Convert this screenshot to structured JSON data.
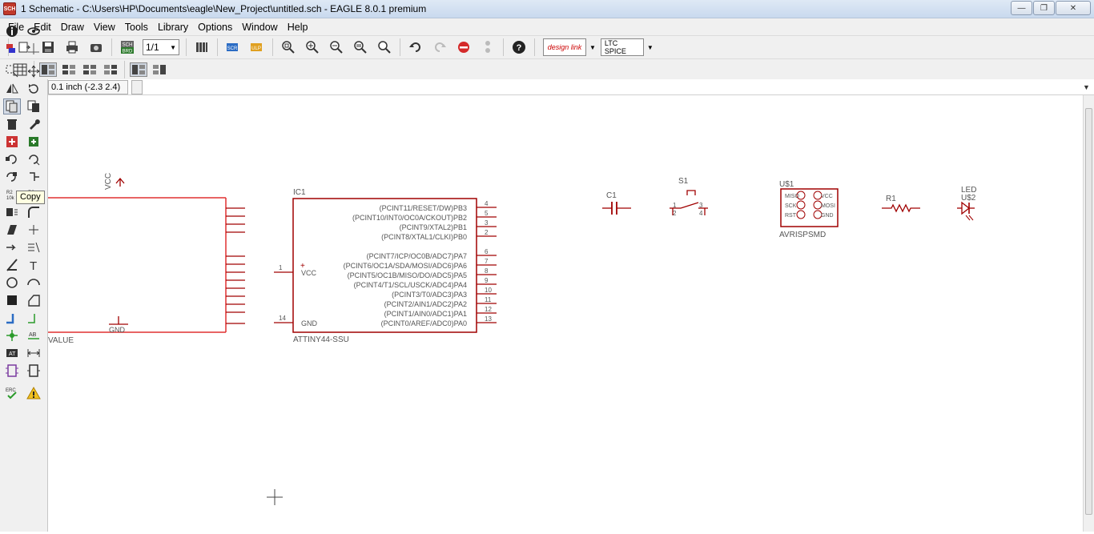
{
  "window": {
    "title": "1 Schematic - C:\\Users\\HP\\Documents\\eagle\\New_Project\\untitled.sch - EAGLE 8.0.1 premium",
    "icon_label": "SCH"
  },
  "menu": [
    "File",
    "Edit",
    "Draw",
    "View",
    "Tools",
    "Library",
    "Options",
    "Window",
    "Help"
  ],
  "toolbar": {
    "sheet_select": "1/1",
    "sch_brd_label": "SCH BRD",
    "design_link_label": "design link",
    "ltc_spice_label": "LTC SPICE"
  },
  "command": {
    "coordinate_display": "0.1 inch (-2.3 2.4)",
    "input_value": ""
  },
  "tooltip": "Copy",
  "schematic": {
    "frame_part": {
      "value_label": "VALUE",
      "vcc_label": "VCC",
      "gnd_label": "GND"
    },
    "ic1": {
      "name": "IC1",
      "value": "ATTINY44-SSU",
      "left_pins": [
        {
          "num": "1",
          "name": "VCC"
        },
        {
          "num": "14",
          "name": "GND"
        }
      ],
      "right_pins": [
        {
          "num": "4",
          "name": "(PCINT11/RESET/DW)PB3"
        },
        {
          "num": "5",
          "name": "(PCINT10/INT0/OC0A/CKOUT)PB2"
        },
        {
          "num": "3",
          "name": "(PCINT9/XTAL2)PB1"
        },
        {
          "num": "2",
          "name": "(PCINT8/XTAL1/CLKI)PB0"
        },
        {
          "num": "6",
          "name": "(PCINT7/ICP/OC0B/ADC7)PA7"
        },
        {
          "num": "7",
          "name": "(PCINT6/OC1A/SDA/MOSI/ADC6)PA6"
        },
        {
          "num": "8",
          "name": "(PCINT5/OC1B/MISO/DO/ADC5)PA5"
        },
        {
          "num": "9",
          "name": "(PCINT4/T1/SCL/USCK/ADC4)PA4"
        },
        {
          "num": "10",
          "name": "(PCINT3/T0/ADC3)PA3"
        },
        {
          "num": "11",
          "name": "(PCINT2/AIN1/ADC2)PA2"
        },
        {
          "num": "12",
          "name": "(PCINT1/AIN0/ADC1)PA1"
        },
        {
          "num": "13",
          "name": "(PCINT0/AREF/ADC0)PA0"
        }
      ]
    },
    "c1": {
      "name": "C1"
    },
    "s1": {
      "name": "S1",
      "pins": [
        "1",
        "3",
        "2",
        "4"
      ]
    },
    "header": {
      "name": "U$1",
      "value": "AVRISPSMD",
      "left_pins": [
        "MISO",
        "SCK",
        "RST"
      ],
      "right_pins": [
        "VCC",
        "MOSI",
        "GND"
      ]
    },
    "r1": {
      "name": "R1"
    },
    "led": {
      "name": "LED",
      "value": "U$2"
    }
  },
  "colors": {
    "part_outline": "#a00000",
    "pin_line": "#a00000",
    "text": "#555555",
    "frame_line": "#e03030"
  }
}
